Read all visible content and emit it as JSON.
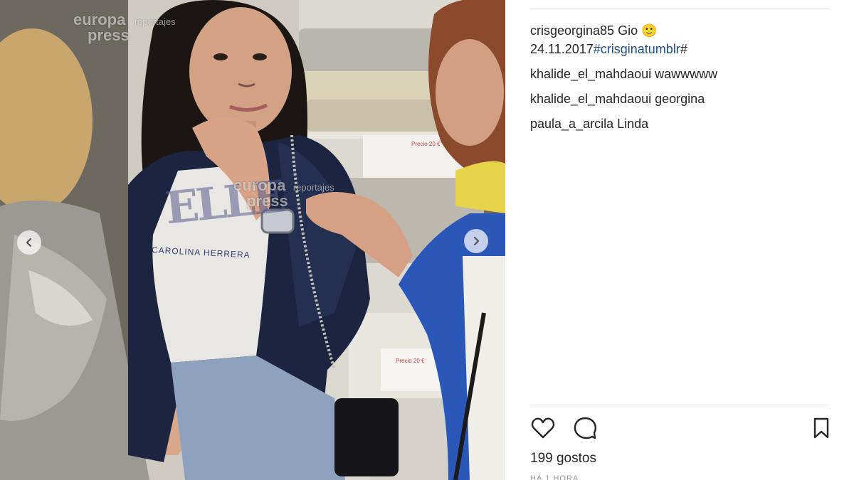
{
  "photo": {
    "alt": "Instagram post photo",
    "watermarks": [
      {
        "main": "europa",
        "main2": "press",
        "sub": "reportajes"
      },
      {
        "main": "europa",
        "main2": "press",
        "sub": "reportajes"
      }
    ],
    "shirt_text": "ELLE",
    "shirt_brand": "CAROLINA HERRERA",
    "price_tag_1": "Precio 20 €",
    "price_tag_2": "Precio 20 €"
  },
  "post": {
    "caption": {
      "user": "crisgeorgina85",
      "text": " Gio 🙂",
      "date": "24.11.2017",
      "hashtag": "#crisginatumblr",
      "trailing": "#"
    },
    "comments": [
      {
        "user": "khalide_el_mahdaoui",
        "text": " wawwwww"
      },
      {
        "user": "khalide_el_mahdaoui",
        "text": " georgina"
      },
      {
        "user": "paula_a_arcila",
        "text": " Linda"
      }
    ],
    "likes": "199 gostos",
    "time_ago": "HÁ 1 HORA"
  },
  "icons": {
    "like": "heart-icon",
    "comment": "comment-bubble-icon",
    "save": "bookmark-icon",
    "prev": "chevron-left-icon",
    "next": "chevron-right-icon"
  },
  "colors": {
    "text": "#262626",
    "hashtag": "#1e4f8f",
    "muted": "#999999",
    "divider": "#e6e6e6"
  }
}
